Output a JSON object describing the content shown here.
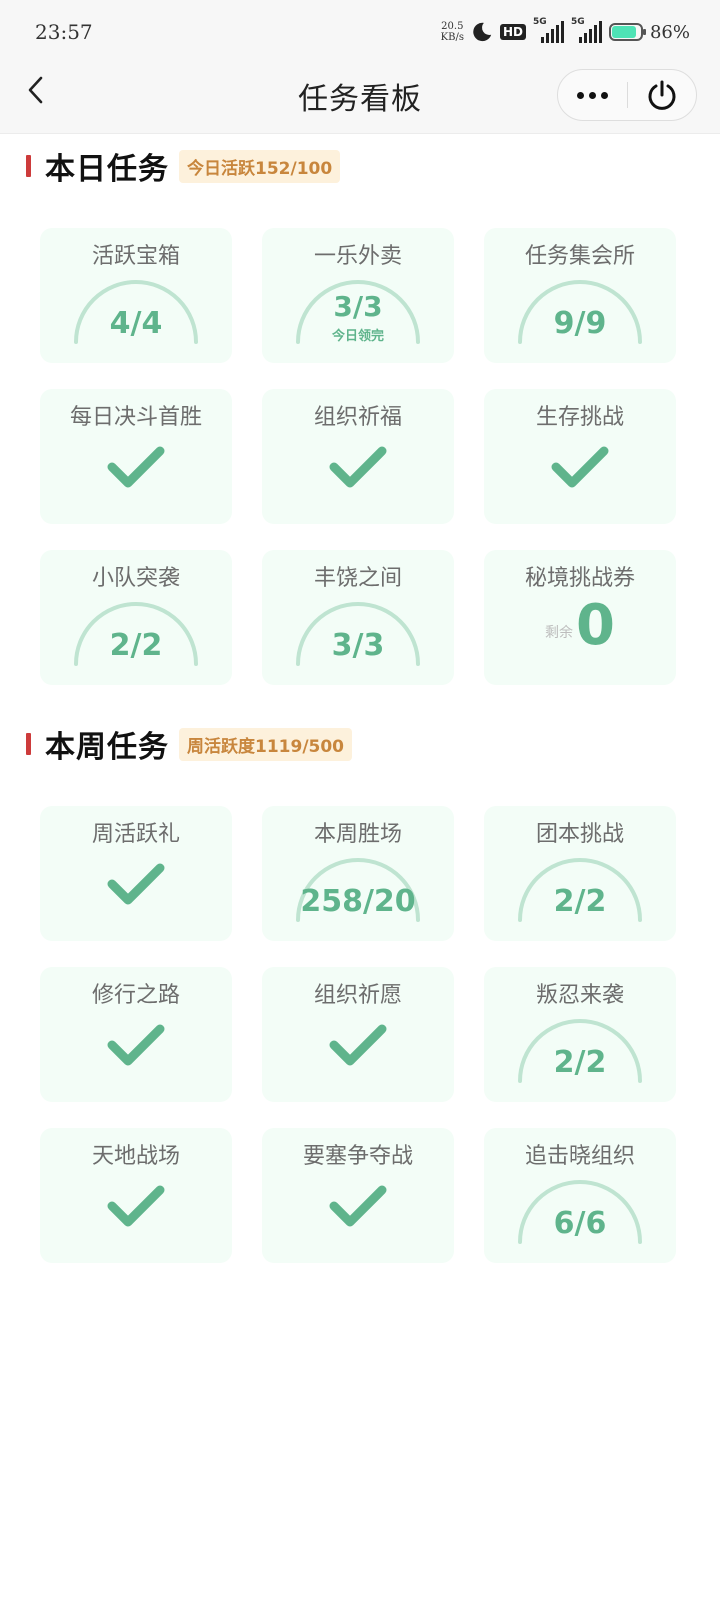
{
  "status_bar": {
    "time": "23:57",
    "speed_value": "20.5",
    "speed_unit": "KB/s",
    "hd_label": "HD",
    "sim1_label": "5G",
    "sim2_label": "5G",
    "battery_percent": "86%",
    "battery_level": 0.86,
    "battery_color": "#4ee3b5"
  },
  "nav": {
    "title": "任务看板",
    "back_icon": "chevron-left-icon",
    "more_icon": "more-dots-icon",
    "power_icon": "power-icon"
  },
  "colors": {
    "accent_green": "#5fb48c",
    "card_bg": "#f3fdf7",
    "section_bar": "#cd3b3b",
    "badge_bg": "#fdf1dc",
    "badge_text": "#c8863d"
  },
  "daily": {
    "title": "本日任务",
    "badge": "今日活跃152/100",
    "cards": [
      {
        "title": "活跃宝箱",
        "type": "gauge",
        "value": "4/4"
      },
      {
        "title": "一乐外卖",
        "type": "gauge",
        "value": "3/3",
        "sub": "今日领完"
      },
      {
        "title": "任务集会所",
        "type": "gauge",
        "value": "9/9"
      },
      {
        "title": "每日决斗首胜",
        "type": "check"
      },
      {
        "title": "组织祈福",
        "type": "check"
      },
      {
        "title": "生存挑战",
        "type": "check"
      },
      {
        "title": "小队突袭",
        "type": "gauge",
        "value": "2/2"
      },
      {
        "title": "丰饶之间",
        "type": "gauge",
        "value": "3/3"
      },
      {
        "title": "秘境挑战券",
        "type": "remain",
        "label": "剩余",
        "value": "0"
      }
    ]
  },
  "weekly": {
    "title": "本周任务",
    "badge": "周活跃度1119/500",
    "cards": [
      {
        "title": "周活跃礼",
        "type": "check"
      },
      {
        "title": "本周胜场",
        "type": "gauge",
        "value": "258/20"
      },
      {
        "title": "团本挑战",
        "type": "gauge",
        "value": "2/2"
      },
      {
        "title": "修行之路",
        "type": "check"
      },
      {
        "title": "组织祈愿",
        "type": "check"
      },
      {
        "title": "叛忍来袭",
        "type": "gauge",
        "value": "2/2"
      },
      {
        "title": "天地战场",
        "type": "check"
      },
      {
        "title": "要塞争夺战",
        "type": "check"
      },
      {
        "title": "追击晓组织",
        "type": "gauge",
        "value": "6/6"
      }
    ]
  }
}
